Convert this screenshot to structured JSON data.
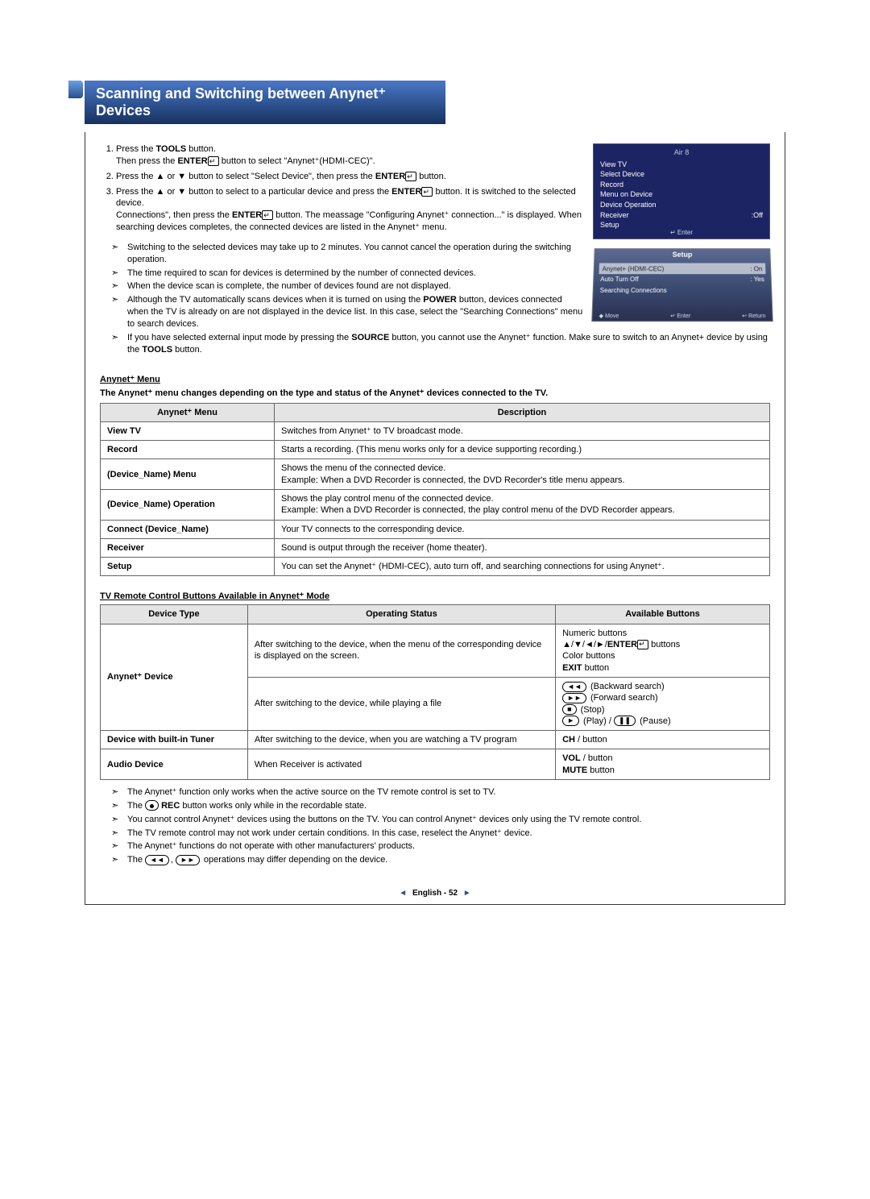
{
  "title": "Scanning and Switching between Anynet⁺ Devices",
  "steps": {
    "s1a": "Press the ",
    "s1a_b": "TOOLS",
    "s1a2": " button.",
    "s1b": "Then press the ",
    "s1b_b": "ENTER",
    "s1b2": " button to select \"Anynet⁺(HDMI-CEC)\".",
    "s2": "Press the ▲ or ▼ button to select \"Select Device\", then press the ",
    "s2_b": "ENTER",
    "s2b": " button.",
    "s3a": "Press the ▲ or ▼ button to select to a particular device and press the ",
    "s3a_b": "ENTER",
    "s3a2": " button. It is switched to the selected device.",
    "s3b": "Connections\", then press the ",
    "s3b_b": "ENTER",
    "s3b2": " button. The meassage \"Configuring Anynet⁺ connection...\" is displayed. When searching devices completes, the connected devices are listed in the Anynet⁺ menu."
  },
  "arrows_top": [
    "Switching to the selected devices may take up to 2 minutes. You cannot cancel the operation during the switching operation.",
    "The time required to scan for devices is determined by the number of connected devices.",
    "When the device scan is complete, the number of devices found are not displayed."
  ],
  "arrow_power_pre": "Although the TV automatically scans devices when it is turned on using the ",
  "arrow_power_b": "POWER",
  "arrow_power_post": " button, devices connected when the TV is already on are not displayed in the device list. In this case, select the \"Searching Connections\" menu to search devices.",
  "arrow_source_pre": "If you have selected external input mode by pressing the ",
  "arrow_source_b": "SOURCE",
  "arrow_source_post": " button, you cannot use the Anynet⁺ function. Make sure to switch to an Anynet+ device by using the ",
  "arrow_source_b2": "TOOLS",
  "arrow_source_post2": " button.",
  "osd1": {
    "hdr1": "Air 8",
    "rows": [
      "View TV",
      "Select Device",
      "Record",
      "Menu on Device",
      "Device Operation"
    ],
    "recv_l": "Receiver",
    "recv_r": ":Off",
    "setup": "Setup",
    "enter": "↵ Enter"
  },
  "osd2": {
    "title": "Setup",
    "row1_l": "Anynet+ (HDMI-CEC)",
    "row1_r": ": On",
    "row2_l": "Auto Turn Off",
    "row2_r": ": Yes",
    "row3": "Searching Connections",
    "move": "◆ Move",
    "enter": "↵ Enter",
    "return": "↩ Return"
  },
  "section1_head": "Anynet⁺ Menu",
  "section1_intro": "The Anynet⁺ menu changes depending on the type and status of the Anynet⁺ devices connected to the TV.",
  "t1": {
    "h1": "Anynet⁺ Menu",
    "h2": "Description",
    "rows": [
      {
        "a": "View TV",
        "b": "Switches from Anynet⁺ to TV broadcast mode."
      },
      {
        "a": "Record",
        "b": "Starts a recording. (This menu works only for a device supporting recording.)"
      },
      {
        "a": "(Device_Name) Menu",
        "b": "Shows the menu of the connected device.\nExample: When a DVD Recorder is connected, the DVD Recorder's title menu appears."
      },
      {
        "a": "(Device_Name) Operation",
        "b": "Shows the play control menu of the connected device.\nExample: When a DVD Recorder is connected, the play control menu of the DVD Recorder appears."
      },
      {
        "a": "Connect (Device_Name)",
        "b": "Your TV connects to the corresponding device."
      },
      {
        "a": "Receiver",
        "b": "Sound is output through the receiver (home theater)."
      },
      {
        "a": "Setup",
        "b": "You can set the Anynet⁺ (HDMI-CEC), auto turn off, and searching connections for using Anynet⁺."
      }
    ]
  },
  "section2_head": "TV  Remote Control Buttons Available in Anynet⁺ Mode",
  "t2": {
    "h1": "Device Type",
    "h2": "Operating Status",
    "h3": "Available Buttons",
    "r1a": "Anynet⁺ Device",
    "r1b": "After switching to the device, when the menu of the corresponding device is displayed on the screen.",
    "r1c_l1": "Numeric buttons",
    "r1c_l2a": "▲/▼/◄/►/",
    "r1c_l2b": "ENTER",
    "r1c_l2c": " buttons",
    "r1c_l3": "Color buttons",
    "r1c_l4a": "EXIT",
    "r1c_l4b": " button",
    "r2b": "After switching to the device, while playing a file",
    "r2c_1": "(Backward search)",
    "r2c_2": "(Forward search)",
    "r2c_3": "(Stop)",
    "r2c_4": "(Play) /",
    "r2c_4b": "(Pause)",
    "r3a": "Device with built-in Tuner",
    "r3b": "After switching to the device, when you are watching a TV program",
    "r3c_a": "CH",
    "r3c_b": "   /    button",
    "r4a": "Audio Device",
    "r4b": "When Receiver is activated",
    "r4c_a": "VOL",
    "r4c_b": "   /    button",
    "r4c_c": "MUTE",
    "r4c_d": " button"
  },
  "bottom_arrows": {
    "a1": "The Anynet⁺ function only works when the active source on the TV remote control is set to TV.",
    "a2_pre": "The ",
    "a2_b": "REC",
    "a2_post": " button works only while in the recordable state.",
    "a3": "You cannot control Anynet⁺ devices using the buttons on the TV. You can control Anynet⁺ devices only using the TV remote control.",
    "a4": "The TV remote control may not work under certain conditions. In this case, reselect the Anynet⁺ device.",
    "a5": "The Anynet⁺ functions do not operate with other manufacturers' products.",
    "a6_pre": "The ",
    "a6_post": " operations may differ depending on the device."
  },
  "footer": "English - 52"
}
